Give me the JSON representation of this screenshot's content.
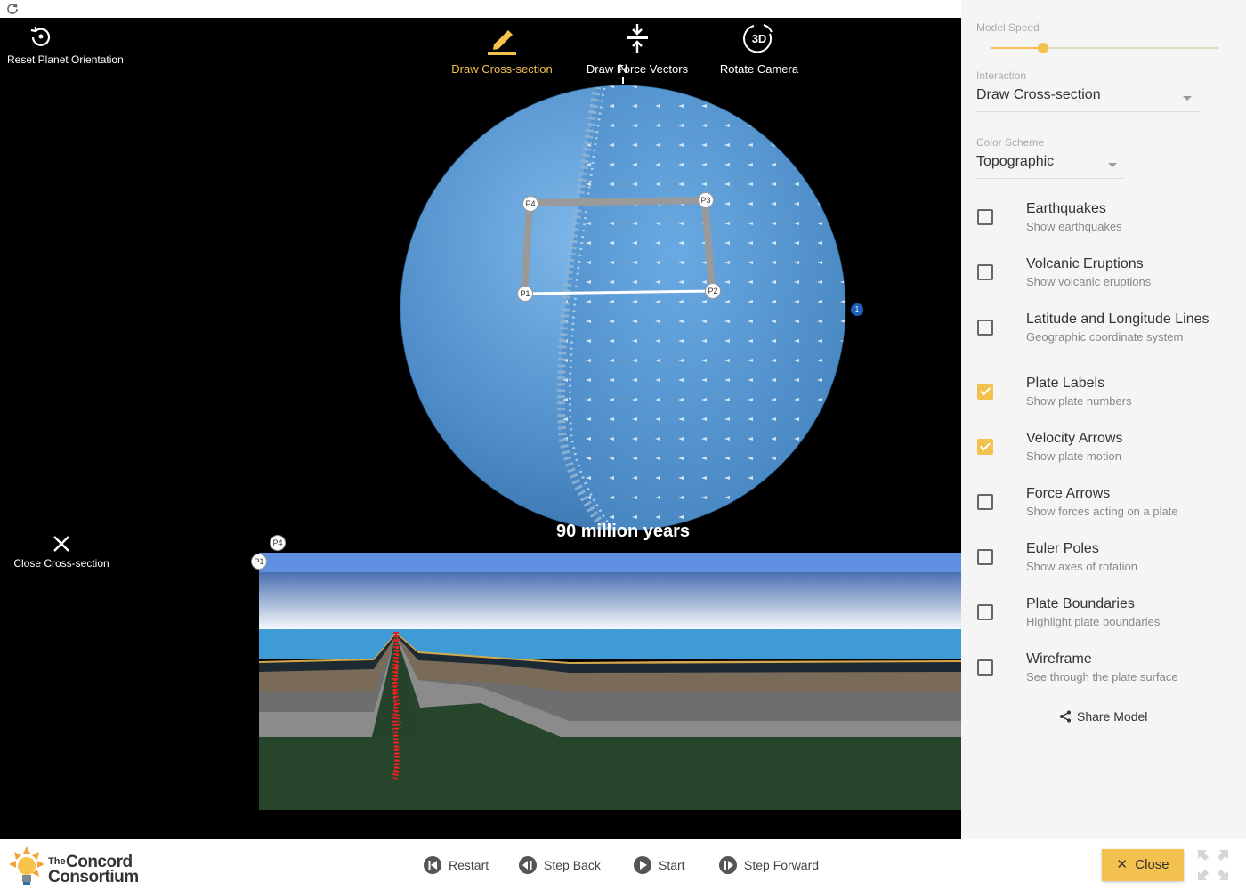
{
  "toolbar": {
    "reset_orientation": "Reset Planet Orientation",
    "draw_cross_section": "Draw Cross-section",
    "draw_force_vectors": "Draw Force Vectors",
    "rotate_camera": "Rotate Camera",
    "rotate_camera_icon_text": "3D",
    "active_tool": "Draw Cross-section"
  },
  "viewport": {
    "close_cross_section": "Close Cross-section",
    "time_label": "90 million years",
    "north_label": "N",
    "plate_number": "1",
    "markers": [
      "P1",
      "P2",
      "P3",
      "P4"
    ],
    "cross_section_markers": [
      "P1",
      "P4"
    ]
  },
  "sidebar": {
    "model_speed_label": "Model Speed",
    "model_speed_fraction": 0.23,
    "interaction_label": "Interaction",
    "interaction_value": "Draw Cross-section",
    "color_scheme_label": "Color Scheme",
    "color_scheme_value": "Topographic",
    "options": [
      {
        "title": "Earthquakes",
        "desc": "Show earthquakes",
        "checked": false
      },
      {
        "title": "Volcanic Eruptions",
        "desc": "Show volcanic eruptions",
        "checked": false
      },
      {
        "title": "Latitude and Longitude Lines",
        "desc": "Geographic coordinate system",
        "checked": false
      },
      {
        "title": "Plate Labels",
        "desc": "Show plate numbers",
        "checked": true
      },
      {
        "title": "Velocity Arrows",
        "desc": "Show plate motion",
        "checked": true
      },
      {
        "title": "Force Arrows",
        "desc": "Show forces acting on a plate",
        "checked": false
      },
      {
        "title": "Euler Poles",
        "desc": "Show axes of rotation",
        "checked": false
      },
      {
        "title": "Plate Boundaries",
        "desc": "Highlight plate boundaries",
        "checked": false
      },
      {
        "title": "Wireframe",
        "desc": "See through the plate surface",
        "checked": false
      }
    ],
    "share_label": "Share Model"
  },
  "bottom": {
    "logo_the": "The",
    "logo_concord": "Concord",
    "logo_consortium": "Consortium",
    "restart": "Restart",
    "step_back": "Step Back",
    "start": "Start",
    "step_forward": "Step Forward",
    "close": "Close"
  },
  "colors": {
    "accent": "#f2c14e",
    "ocean": "#5b9bd5",
    "mantle": "#27452b",
    "magma": "#e02020"
  },
  "icons": [
    "reload-icon",
    "reset-orientation-icon",
    "pencil-icon",
    "force-vectors-icon",
    "rotate-3d-icon",
    "close-icon",
    "share-icon",
    "restart-icon",
    "step-back-icon",
    "start-icon",
    "step-forward-icon",
    "fullscreen-icon",
    "concord-logo-icon"
  ]
}
